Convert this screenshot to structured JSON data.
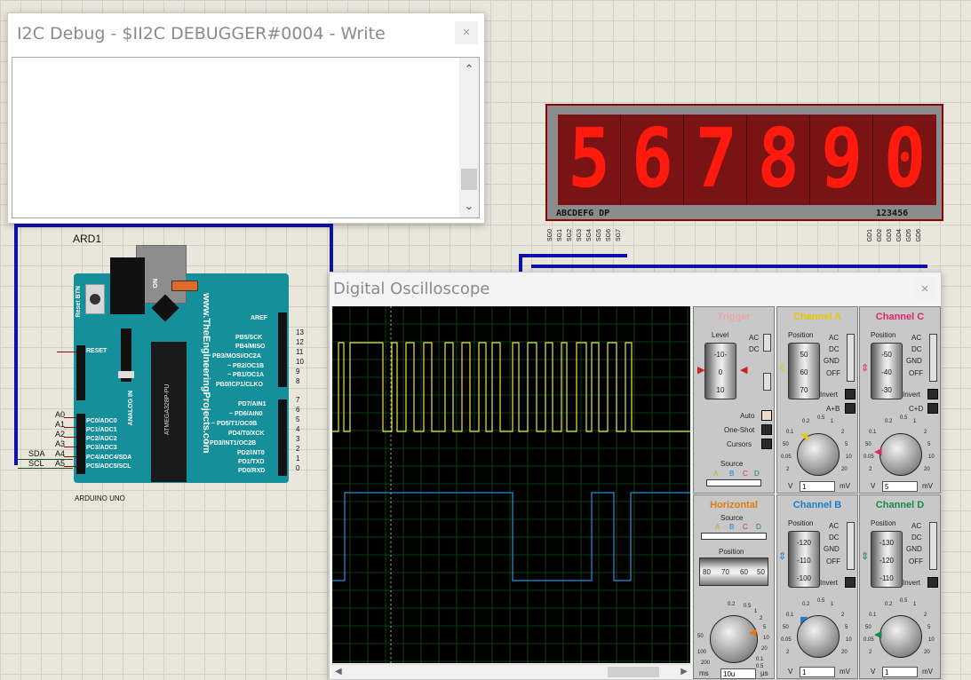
{
  "i2c_window": {
    "title": "I2C Debug - $II2C DEBUGGER#0004 - Write",
    "close": "×",
    "scroll_up": "⌃",
    "scroll_down": "⌄"
  },
  "arduino": {
    "ref": "ARD1",
    "name": "ARDUINO UNO",
    "brand": "www.TheEngineeringProjects.com",
    "chip": "ATMEGA328P-PU",
    "reset_label": "Reset BTN",
    "on_label": "ON",
    "analog_label": "ANALOG IN",
    "left_pins": [
      "RESET",
      "PC0/ADC0",
      "PC1/ADC1",
      "PC2/ADC2",
      "PC3/ADC3",
      "PC4/ADC4/SDA",
      "PC5/ADC5/SCL"
    ],
    "analog_ext": [
      "A0",
      "A1",
      "A2",
      "A3",
      "A4",
      "A5"
    ],
    "right_pins_top": [
      "AREF",
      "PB5/SCK",
      "PB4/MISO",
      "~ PB3/MOSI/OC2A",
      "~ PB2/OC1B",
      "~ PB1/OC1A",
      "PB0/ICP1/CLKO"
    ],
    "right_nums_top": [
      "13",
      "12",
      "11",
      "10",
      "9",
      "8"
    ],
    "right_pins_bottom": [
      "PD7/AIN1",
      "~ PD6/AIN0",
      "~ PD5/T1/OC0B",
      "PD4/T0/XCK",
      "~ PD3/INT1/OC2B",
      "PD2/INT0",
      "PD1/TXD",
      "PD0/RXD"
    ],
    "right_nums_bottom": [
      "7",
      "6",
      "5",
      "4",
      "3",
      "2",
      "1",
      "0"
    ],
    "bus_labels": [
      "SDA",
      "SCL"
    ]
  },
  "seven_segment": {
    "digits": [
      "5",
      "6",
      "7",
      "8",
      "9",
      "0"
    ],
    "seg_label": "ABCDEFG DP",
    "digit_label": "123456",
    "seg_pins": [
      "SG0",
      "SG1",
      "SG2",
      "SG3",
      "SG4",
      "SG5",
      "SG6",
      "SG7"
    ],
    "digit_pins": [
      "GD1",
      "GD2",
      "GD3",
      "GD4",
      "GD5",
      "GD6"
    ],
    "colors": {
      "lit": "#ff1a0d",
      "face": "#7a1414"
    }
  },
  "oscilloscope": {
    "title": "Digital Oscilloscope",
    "close": "×",
    "trace_colors": {
      "a": "#e6e64a",
      "b": "#2b8fd6"
    },
    "trigger": {
      "title": "Trigger",
      "level_label": "Level",
      "level_ticks": [
        "-10-",
        "0",
        "10"
      ],
      "coupling": [
        "AC",
        "DC"
      ],
      "modes": [
        "Auto",
        "One-Shot",
        "Cursors"
      ],
      "source_label": "Source",
      "source_channels": [
        "A",
        "B",
        "C",
        "D"
      ]
    },
    "channel_a": {
      "title": "Channel A",
      "color": "#e6c800",
      "position_label": "Position",
      "ticks": [
        "50",
        "60",
        "70"
      ],
      "coupling": [
        "AC",
        "DC",
        "GND",
        "OFF"
      ],
      "invert": "Invert",
      "combine": "A+B",
      "scale": [
        "0.2",
        "0.5",
        "1",
        "2",
        "5",
        "10",
        "20",
        "0.1",
        "50",
        "0.05",
        "2"
      ],
      "units": [
        "V",
        "mV"
      ],
      "value": "1"
    },
    "channel_c": {
      "title": "Channel C",
      "color": "#d9286a",
      "position_label": "Position",
      "ticks": [
        "-50",
        "-40",
        "-30"
      ],
      "coupling": [
        "AC",
        "DC",
        "GND",
        "OFF"
      ],
      "invert": "Invert",
      "combine": "C+D",
      "scale": [
        "0.2",
        "0.5",
        "1",
        "2",
        "5",
        "10",
        "20",
        "0.1",
        "50",
        "0.05",
        "2"
      ],
      "units": [
        "V",
        "mV"
      ],
      "value": "5"
    },
    "horizontal": {
      "title": "Horizontal",
      "color": "#e07a10",
      "source_label": "Source",
      "source_channels": [
        "A",
        "B",
        "C",
        "D"
      ],
      "position_label": "Position",
      "ticks": [
        "80",
        "70",
        "60",
        "50"
      ],
      "scale": [
        "0.2",
        "0.5",
        "1",
        "2",
        "5",
        "10",
        "20",
        "50",
        "100",
        "200",
        "0.1",
        "0.5"
      ],
      "units": [
        "ms",
        "µs"
      ],
      "value": "10u"
    },
    "channel_b": {
      "title": "Channel B",
      "color": "#1b7fd0",
      "position_label": "Position",
      "ticks": [
        "-120",
        "-110",
        "-100"
      ],
      "coupling": [
        "AC",
        "DC",
        "GND",
        "OFF"
      ],
      "invert": "Invert",
      "scale": [
        "0.2",
        "0.5",
        "1",
        "2",
        "5",
        "10",
        "20",
        "0.1",
        "50",
        "0.05",
        "2"
      ],
      "units": [
        "V",
        "mV"
      ],
      "value": "1"
    },
    "channel_d": {
      "title": "Channel D",
      "color": "#15894a",
      "position_label": "Position",
      "ticks": [
        "-130",
        "-120",
        "-110"
      ],
      "coupling": [
        "AC",
        "DC",
        "GND",
        "OFF"
      ],
      "invert": "Invert",
      "scale": [
        "0.2",
        "0.5",
        "1",
        "2",
        "5",
        "10",
        "20",
        "0.1",
        "50",
        "0.05",
        "2"
      ],
      "units": [
        "V",
        "mV"
      ],
      "value": "1"
    }
  }
}
